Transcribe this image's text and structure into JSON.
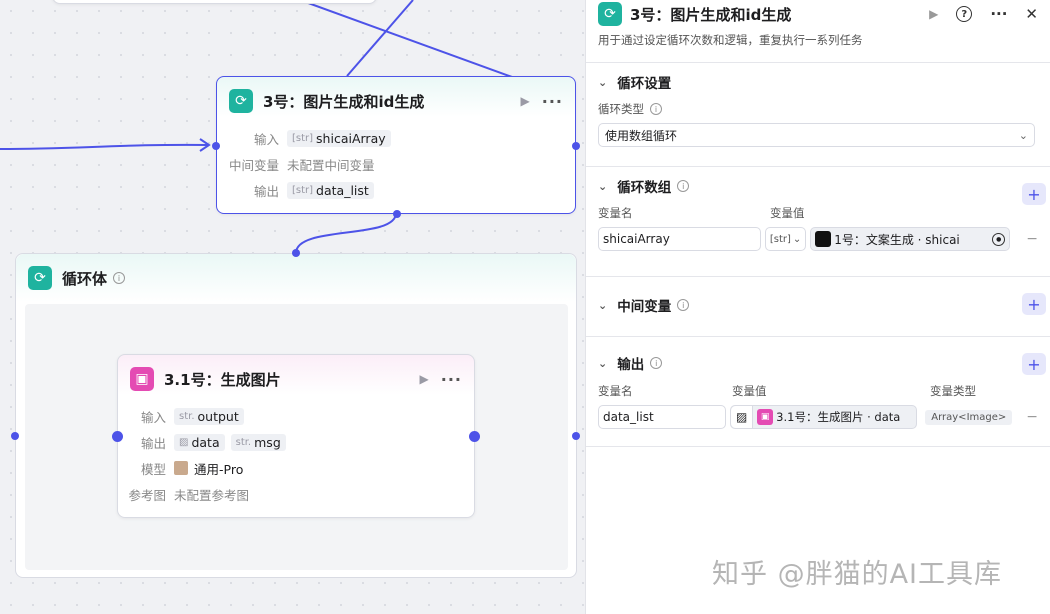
{
  "main_node": {
    "title": "3号：图片生成和id生成",
    "input_label": "输入",
    "input_type": "[str]",
    "input_value": "shicaiArray",
    "mid_label": "中间变量",
    "mid_value": "未配置中间变量",
    "output_label": "输出",
    "output_type": "[str]",
    "output_value": "data_list"
  },
  "loop_body": {
    "title": "循环体"
  },
  "child_node": {
    "title": "3.1号：生成图片",
    "input_label": "输入",
    "input_type": "str.",
    "input_value": "output",
    "output_label": "输出",
    "output_value_1": "data",
    "output_type_2": "str.",
    "output_value_2": "msg",
    "model_label": "模型",
    "model_value": "通用-Pro",
    "ref_label": "参考图",
    "ref_value": "未配置参考图"
  },
  "panel": {
    "title": "3号：图片生成和id生成",
    "description": "用于通过设定循环次数和逻辑，重复执行一系列任务",
    "loop_settings": {
      "header": "循环设置",
      "type_label": "循环类型",
      "type_value": "使用数组循环"
    },
    "loop_array": {
      "header": "循环数组",
      "col_name": "变量名",
      "col_value": "变量值",
      "var_name": "shicaiArray",
      "var_type": "[str]",
      "var_ref": "1号：文案生成 · shicai"
    },
    "middle_vars": {
      "header": "中间变量"
    },
    "output": {
      "header": "输出",
      "col_name": "变量名",
      "col_value": "变量值",
      "col_type": "变量类型",
      "var_name": "data_list",
      "var_ref": "3.1号：生成图片 · data",
      "var_type": "Array<Image>"
    }
  },
  "watermark": "知乎 @胖猫的AI工具库",
  "colors": {
    "accent": "#4d53e8",
    "loop_icon": "#1fb39f",
    "image_icon": "#e44bb3"
  }
}
